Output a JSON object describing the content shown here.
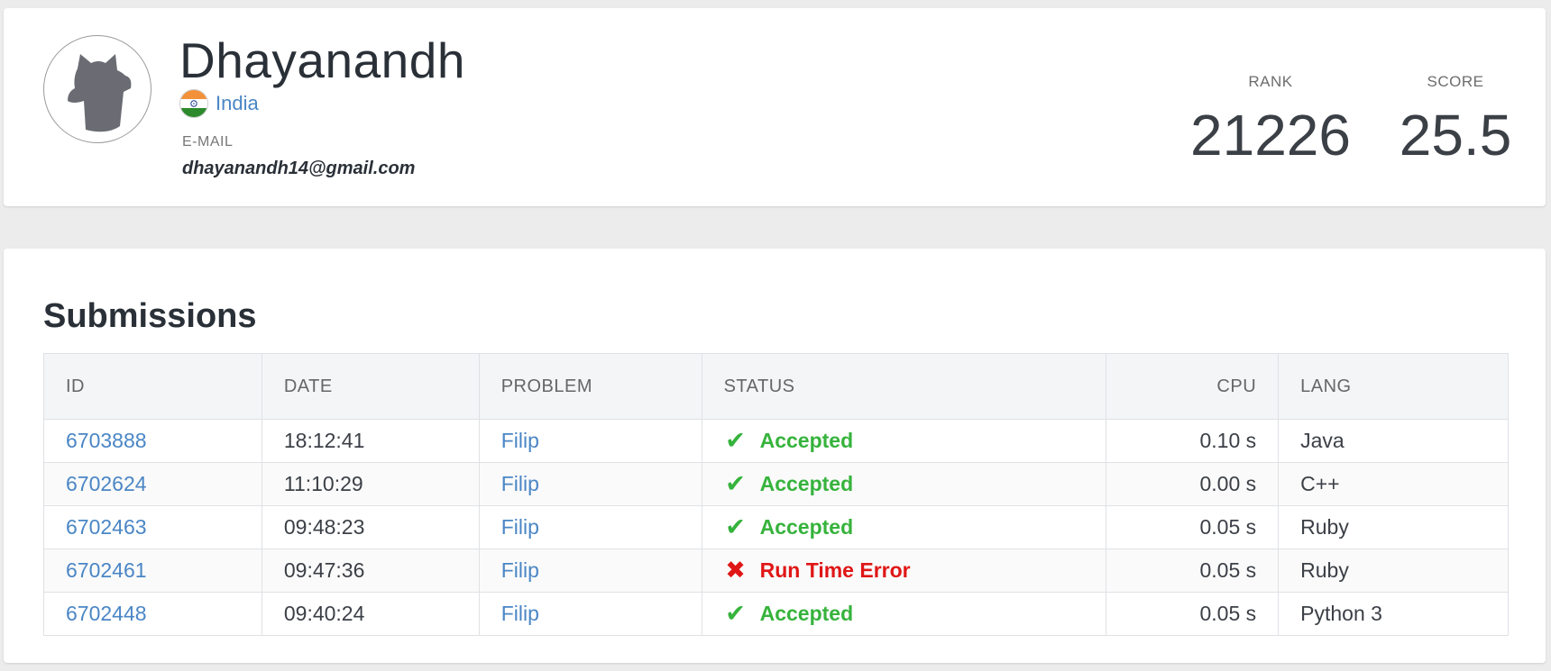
{
  "profile": {
    "name": "Dhayanandh",
    "country": "India",
    "email_label": "E-MAIL",
    "email": "dhayanandh14@gmail.com",
    "rank_label": "RANK",
    "rank": "21226",
    "score_label": "SCORE",
    "score": "25.5",
    "avatar_icon": "cat-silhouette-icon",
    "flag_icon": "india-flag-icon"
  },
  "submissions": {
    "title": "Submissions",
    "columns": [
      "ID",
      "DATE",
      "PROBLEM",
      "STATUS",
      "CPU",
      "LANG"
    ],
    "rows": [
      {
        "id": "6703888",
        "date": "18:12:41",
        "problem": "Filip",
        "status": "Accepted",
        "status_icon": "check-icon",
        "cpu": "0.10 s",
        "lang": "Java"
      },
      {
        "id": "6702624",
        "date": "11:10:29",
        "problem": "Filip",
        "status": "Accepted",
        "status_icon": "check-icon",
        "cpu": "0.00 s",
        "lang": "C++"
      },
      {
        "id": "6702463",
        "date": "09:48:23",
        "problem": "Filip",
        "status": "Accepted",
        "status_icon": "check-icon",
        "cpu": "0.05 s",
        "lang": "Ruby"
      },
      {
        "id": "6702461",
        "date": "09:47:36",
        "problem": "Filip",
        "status": "Run Time Error",
        "status_icon": "cross-icon",
        "cpu": "0.05 s",
        "lang": "Ruby"
      },
      {
        "id": "6702448",
        "date": "09:40:24",
        "problem": "Filip",
        "status": "Accepted",
        "status_icon": "check-icon",
        "cpu": "0.05 s",
        "lang": "Python 3"
      }
    ]
  },
  "colors": {
    "link": "#4a86c5",
    "accepted": "#36b33c",
    "error": "#e01616",
    "background": "#ececec"
  }
}
